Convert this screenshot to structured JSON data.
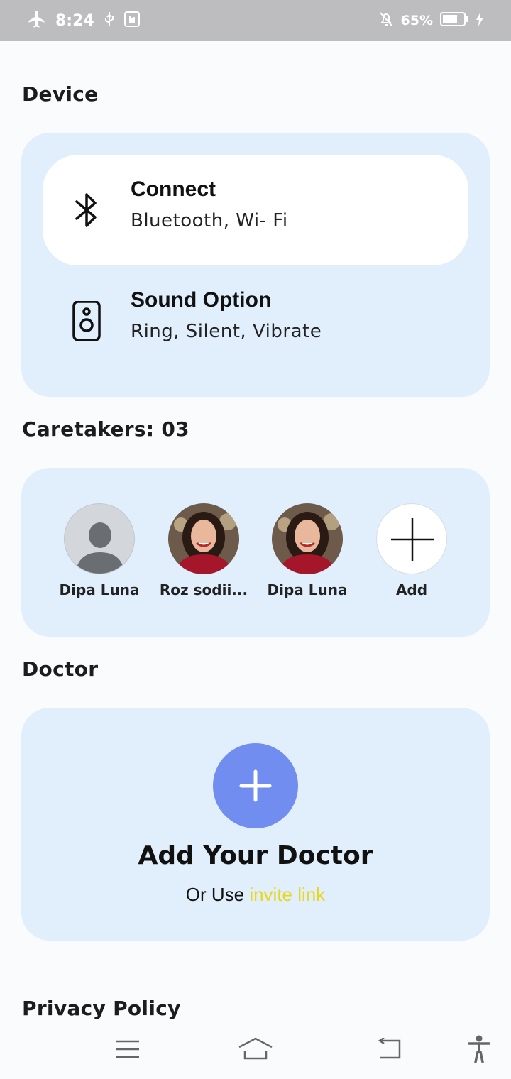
{
  "status_bar": {
    "time": "8:24",
    "battery": "65%",
    "icons": [
      "airplane-icon",
      "usb-icon",
      "usb-debug-icon",
      "alarm-off-icon",
      "battery-icon",
      "charging-icon"
    ]
  },
  "device": {
    "title": "Device",
    "items": [
      {
        "title": "Connect",
        "subtitle": "Bluetooth, Wi- Fi",
        "icon": "bluetooth-icon"
      },
      {
        "title": "Sound Option",
        "subtitle": "Ring, Silent, Vibrate",
        "icon": "speaker-icon"
      }
    ]
  },
  "caretakers": {
    "title": "Caretakers: 03",
    "items": [
      {
        "name": "Dipa Luna",
        "avatar": "placeholder"
      },
      {
        "name": "Roz sodii...",
        "avatar": "photo"
      },
      {
        "name": "Dipa Luna",
        "avatar": "photo"
      }
    ],
    "add_label": "Add"
  },
  "doctor": {
    "title": "Doctor",
    "add_title": "Add Your Doctor",
    "invite_prefix": "Or Use ",
    "invite_link": "invite link"
  },
  "privacy": {
    "title": "Privacy Policy"
  },
  "nav": {
    "icons": [
      "menu-icon",
      "home-icon",
      "back-icon",
      "accessibility-icon"
    ]
  },
  "colors": {
    "card_bg": "#e1effc",
    "accent": "#718def",
    "link": "#e8d81d",
    "status_bar": "#bdbdbf"
  }
}
